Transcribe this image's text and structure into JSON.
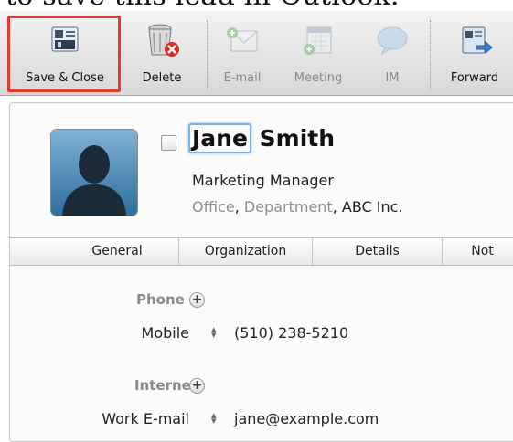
{
  "caption": "to save this lead in Outlook.",
  "toolbar": {
    "buttons": [
      {
        "label": "Save & Close",
        "icon": "save-close-icon"
      },
      {
        "label": "Delete",
        "icon": "delete-trash-icon"
      },
      {
        "label": "E-mail",
        "icon": "email-icon"
      },
      {
        "label": "Meeting",
        "icon": "meeting-calendar-icon"
      },
      {
        "label": "IM",
        "icon": "chat-bubble-icon"
      },
      {
        "label": "Forward",
        "icon": "forward-icon"
      }
    ],
    "highlight_color": "#e33b2d"
  },
  "contact": {
    "first_name": "Jane",
    "last_name": "Smith",
    "job_title": "Marketing Manager",
    "office": "Office",
    "department": "Department",
    "company": "ABC Inc."
  },
  "tabs": [
    "General",
    "Organization",
    "Details",
    "Not"
  ],
  "sections": {
    "phone": {
      "label": "Phone",
      "field_label": "Mobile",
      "value": "(510) 238-5210"
    },
    "internet": {
      "label": "Internet",
      "field_label": "Work E-mail",
      "value": "jane@example.com"
    }
  }
}
